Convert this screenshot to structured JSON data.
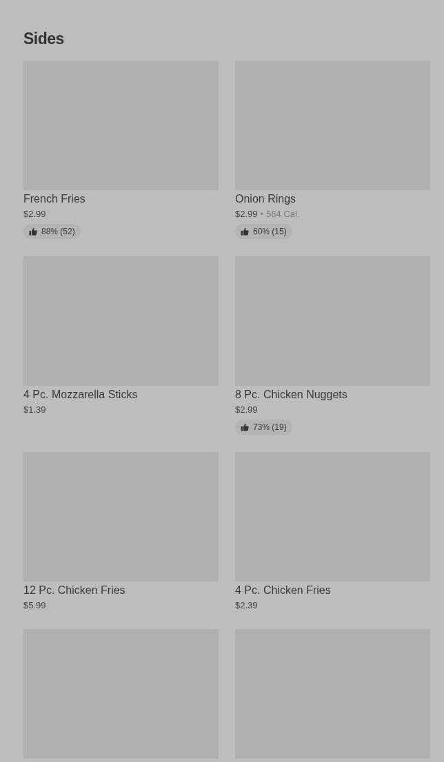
{
  "section": {
    "title": "Sides"
  },
  "items": [
    {
      "kind": "full",
      "name": "French Fries",
      "price": "$2.99",
      "rating": "88% (52)"
    },
    {
      "kind": "full",
      "name": "Onion Rings",
      "price": "$2.99",
      "separator": "•",
      "calories": "564 Cal.",
      "rating": "60% (15)"
    },
    {
      "kind": "full",
      "name": "4 Pc. Mozzarella Sticks",
      "price": "$1.39"
    },
    {
      "kind": "full",
      "name": "8 Pc. Chicken Nuggets",
      "price": "$2.99",
      "rating": "73% (19)"
    },
    {
      "kind": "full",
      "name": "12 Pc. Chicken Fries",
      "price": "$5.99"
    },
    {
      "kind": "full",
      "name": "4 Pc. Chicken Fries",
      "price": "$2.39"
    },
    {
      "kind": "image-only"
    },
    {
      "kind": "image-only"
    }
  ]
}
